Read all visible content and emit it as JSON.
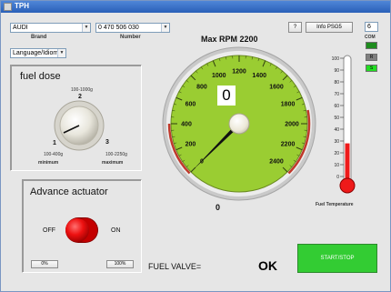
{
  "window": {
    "title": "TPH"
  },
  "brand": {
    "value": "AUDI",
    "label": "Brand"
  },
  "number": {
    "value": "0 470 506 030",
    "label": "Number"
  },
  "language": {
    "value": "Language/Idioma"
  },
  "help_button": "?",
  "info_button": "Info PSG5",
  "com": {
    "value": "6",
    "label": "COM"
  },
  "indicators": [
    {
      "text": "",
      "color": "#1e8c1e"
    },
    {
      "text": "R",
      "color": "#7f7f7f"
    },
    {
      "text": "S",
      "color": "#22dd22"
    }
  ],
  "fuel_dose": {
    "title": "fuel dose",
    "top_range": "100-1000g",
    "pos_top": "2",
    "pos_left": "1",
    "pos_right": "3",
    "left_range": "100-400g",
    "right_range": "100-2250g",
    "left_label": "minimum",
    "right_label": "maximum"
  },
  "advance_actuator": {
    "title": "Advance actuator",
    "off_label": "OFF",
    "on_label": "ON",
    "left_button": "0%",
    "right_button": "100%"
  },
  "rpm": {
    "title": "Max RPM 2200",
    "display": "0",
    "readout": "0",
    "value": 0,
    "scale": [
      "0",
      "200",
      "400",
      "600",
      "800",
      "1000",
      "1200",
      "1400",
      "1600",
      "1800",
      "2000",
      "2200",
      "2400"
    ],
    "max": 2400,
    "dial_color": "#9acd32"
  },
  "thermometer": {
    "scale": [
      "100",
      "90",
      "80",
      "70",
      "60",
      "50",
      "40",
      "30",
      "20",
      "10",
      "0"
    ],
    "value": 28,
    "label": "Fuel Temperature",
    "mercury_color": "#ee1a1a"
  },
  "fuel_valve": {
    "label": "FUEL VALVE=",
    "status": "OK"
  },
  "start_stop": {
    "label": "START/STOP",
    "color": "#33cc33"
  }
}
